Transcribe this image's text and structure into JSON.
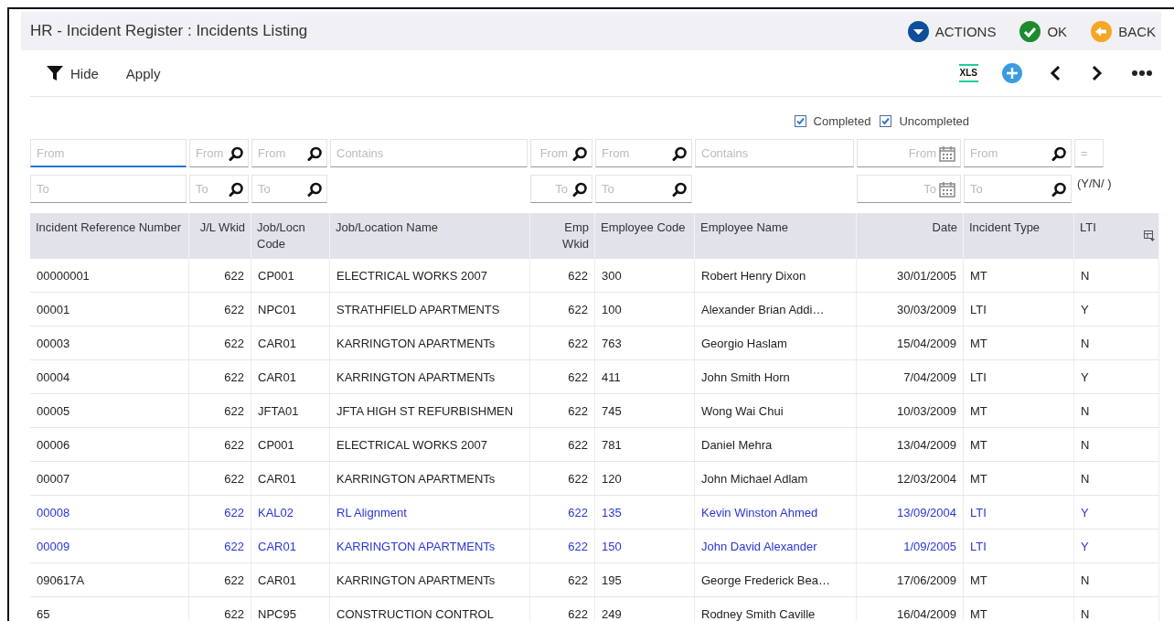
{
  "header": {
    "title": "HR - Incident Register : Incidents Listing",
    "actions": [
      {
        "kind": "actions",
        "label": "ACTIONS"
      },
      {
        "kind": "ok",
        "label": "OK"
      },
      {
        "kind": "back",
        "label": "BACK"
      }
    ]
  },
  "toolbar": {
    "filter_toggle": "Hide",
    "apply": "Apply",
    "tools": [
      {
        "kind": "xls",
        "label": "XLS"
      },
      {
        "kind": "add"
      },
      {
        "kind": "prev"
      },
      {
        "kind": "next"
      },
      {
        "kind": "more"
      }
    ]
  },
  "status_filters": [
    {
      "label": "Completed",
      "checked": true
    },
    {
      "label": "Uncompleted",
      "checked": true
    }
  ],
  "filters": [
    [
      {
        "kind": "text",
        "placeholder": "From",
        "focused": true
      },
      {
        "kind": "lookup",
        "placeholder": "From",
        "focused": false
      },
      {
        "kind": "lookup",
        "placeholder": "From",
        "focused": false
      },
      {
        "kind": "text",
        "placeholder": "Contains",
        "focused": false
      },
      {
        "kind": "lookup",
        "placeholder": "From",
        "focused": false
      },
      {
        "kind": "lookup",
        "placeholder": "From",
        "focused": false
      },
      {
        "kind": "text",
        "placeholder": "Contains",
        "focused": false
      },
      {
        "kind": "date",
        "placeholder": "From",
        "focused": false
      },
      {
        "kind": "lookup",
        "placeholder": "From",
        "focused": false
      },
      {
        "kind": "small",
        "placeholder": "=",
        "focused": false
      }
    ],
    [
      {
        "kind": "text",
        "placeholder": "To",
        "focused": false
      },
      {
        "kind": "lookup",
        "placeholder": "To",
        "focused": false
      },
      {
        "kind": "lookup",
        "placeholder": "To",
        "focused": false
      },
      {
        "kind": "none"
      },
      {
        "kind": "lookup",
        "placeholder": "To",
        "focused": false
      },
      {
        "kind": "lookup",
        "placeholder": "To",
        "focused": false
      },
      {
        "kind": "none"
      },
      {
        "kind": "date",
        "placeholder": "To",
        "focused": false
      },
      {
        "kind": "lookup",
        "placeholder": "To",
        "focused": false
      },
      {
        "kind": "note",
        "text": "(Y/N/  )"
      }
    ]
  ],
  "table": {
    "columns": [
      "Incident Reference Number",
      "J/L Wkid",
      "Job/Locn Code",
      "Job/Location Name",
      "Emp Wkid",
      "Employee Code",
      "Employee Name",
      "Date",
      "Incident Type",
      "LTI"
    ],
    "rows": [
      {
        "selected": false,
        "cells": [
          "00000001",
          "622",
          "CP001",
          "ELECTRICAL WORKS 2007",
          "622",
          "300",
          "Robert Henry Dixon",
          "30/01/2005",
          "MT",
          "N"
        ]
      },
      {
        "selected": false,
        "cells": [
          "00001",
          "622",
          "NPC01",
          "STRATHFIELD APARTMENTS",
          "622",
          "100",
          "Alexander Brian Addi…",
          "30/03/2009",
          "LTI",
          "Y"
        ]
      },
      {
        "selected": false,
        "cells": [
          "00003",
          "622",
          "CAR01",
          "KARRINGTON APARTMENTs",
          "622",
          "763",
          "Georgio Haslam",
          "15/04/2009",
          "MT",
          "N"
        ]
      },
      {
        "selected": false,
        "cells": [
          "00004",
          "622",
          "CAR01",
          "KARRINGTON APARTMENTs",
          "622",
          "411",
          "John Smith Horn",
          "7/04/2009",
          "LTI",
          "Y"
        ]
      },
      {
        "selected": false,
        "cells": [
          "00005",
          "622",
          "JFTA01",
          "JFTA HIGH ST REFURBISHMEN",
          "622",
          "745",
          "Wong Wai Chui",
          "10/03/2009",
          "MT",
          "N"
        ]
      },
      {
        "selected": false,
        "cells": [
          "00006",
          "622",
          "CP001",
          "ELECTRICAL WORKS 2007",
          "622",
          "781",
          "Daniel Mehra",
          "13/04/2009",
          "MT",
          "N"
        ]
      },
      {
        "selected": false,
        "cells": [
          "00007",
          "622",
          "CAR01",
          "KARRINGTON APARTMENTs",
          "622",
          "120",
          "John Michael Adlam",
          "12/03/2004",
          "MT",
          "N"
        ]
      },
      {
        "selected": true,
        "cells": [
          "00008",
          "622",
          "KAL02",
          "RL Alignment",
          "622",
          "135",
          "Kevin Winston Ahmed",
          "13/09/2004",
          "LTI",
          "Y"
        ]
      },
      {
        "selected": true,
        "cells": [
          "00009",
          "622",
          "CAR01",
          "KARRINGTON APARTMENTs",
          "622",
          "150",
          "John David Alexander",
          "1/09/2005",
          "LTI",
          "Y"
        ]
      },
      {
        "selected": false,
        "cells": [
          "090617A",
          "622",
          "CAR01",
          "KARRINGTON APARTMENTs",
          "622",
          "195",
          "George Frederick Bea…",
          "17/06/2009",
          "MT",
          "N"
        ]
      },
      {
        "selected": false,
        "cells": [
          "65",
          "622",
          "NPC95",
          "CONSTRUCTION CONTROL",
          "622",
          "249",
          "Rodney Smith Caville",
          "16/04/2009",
          "MT",
          "N"
        ]
      }
    ]
  }
}
